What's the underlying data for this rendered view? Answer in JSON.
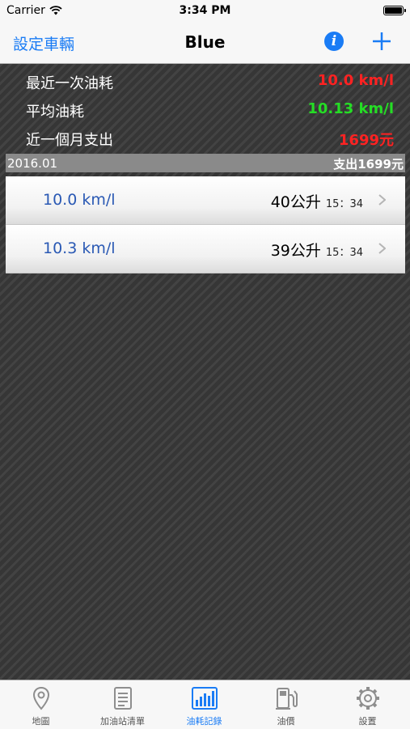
{
  "status_bar": {
    "carrier": "Carrier",
    "time": "3:34 PM"
  },
  "nav": {
    "left_label": "設定車輛",
    "title": "Blue",
    "info_glyph": "i",
    "add_icon": "plus-icon"
  },
  "summary": [
    {
      "label": "最近一次油耗",
      "value": "10.0 km/l",
      "color": "#ff2222"
    },
    {
      "label": "平均油耗",
      "value": "10.13 km/l",
      "color": "#25dd25"
    },
    {
      "label": "近一個月支出",
      "value": "1699元",
      "color": "#ff2222"
    }
  ],
  "section": {
    "month": "2016.01",
    "total": "支出1699元"
  },
  "records": [
    {
      "consumption": "10.0 km/l",
      "liters": "40公升",
      "time": "15：34"
    },
    {
      "consumption": "10.3 km/l",
      "liters": "39公升",
      "time": "15：34"
    }
  ],
  "tabs": [
    {
      "label": "地圖",
      "icon": "map-pin-icon",
      "active": false
    },
    {
      "label": "加油站清單",
      "icon": "list-document-icon",
      "active": false
    },
    {
      "label": "油耗記錄",
      "icon": "bar-chart-icon",
      "active": true
    },
    {
      "label": "油價",
      "icon": "fuel-pump-icon",
      "active": false
    },
    {
      "label": "設置",
      "icon": "gear-icon",
      "active": false
    }
  ],
  "colors": {
    "accent": "#1a7cf5",
    "record_text": "#2a59b4"
  }
}
